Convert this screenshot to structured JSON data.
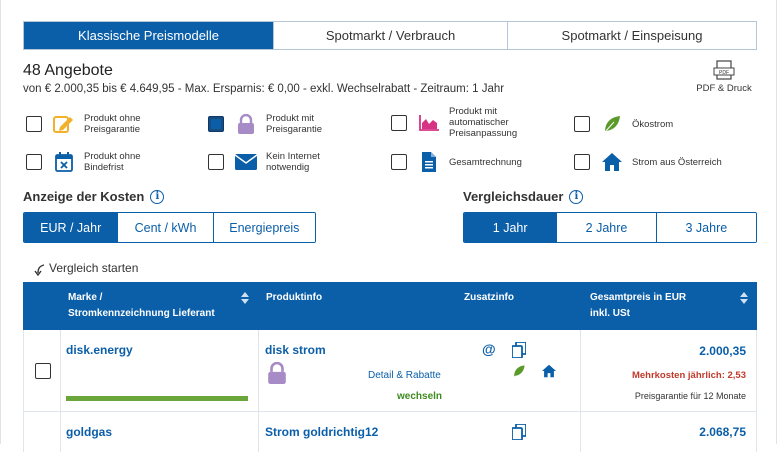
{
  "tabs": [
    "Klassische Preismodelle",
    "Spotmarkt / Verbrauch",
    "Spotmarkt / Einspeisung"
  ],
  "results": {
    "count": "48 Angebote",
    "summary": "von € 2.000,35 bis € 4.649,95 - Max. Ersparnis: € 0,00 - exkl. Wechselrabatt - Zeitraum: 1 Jahr"
  },
  "pdf": {
    "label": "PDF & Druck",
    "icon_text": "PDF"
  },
  "filters": [
    {
      "label": "Produkt ohne Preisgarantie",
      "icon": "edit-icon",
      "checked": false
    },
    {
      "label": "Produkt mit Preisgarantie",
      "icon": "lock-icon",
      "checked": true
    },
    {
      "label": "Produkt mit automatischer Preisanpassung",
      "icon": "area-chart-icon",
      "checked": false
    },
    {
      "label": "Ökostrom",
      "icon": "leaf-icon",
      "checked": false
    },
    {
      "label": "Produkt ohne Bindefrist",
      "icon": "calendar-x-icon",
      "checked": false
    },
    {
      "label": "Kein Internet notwendig",
      "icon": "envelope-icon",
      "checked": false
    },
    {
      "label": "Gesamtrechnung",
      "icon": "document-icon",
      "checked": false
    },
    {
      "label": "Strom aus Österreich",
      "icon": "house-icon",
      "checked": false
    }
  ],
  "cost_display": {
    "title": "Anzeige der Kosten",
    "options": [
      "EUR / Jahr",
      "Cent / kWh",
      "Energiepreis"
    ],
    "selected": "EUR / Jahr"
  },
  "comparison_period": {
    "title": "Vergleichsdauer",
    "options": [
      "1 Jahr",
      "2 Jahre",
      "3 Jahre"
    ],
    "selected": "1 Jahr"
  },
  "compare_label": "Vergleich starten",
  "table": {
    "headers": {
      "brand": [
        "Marke /",
        "Stromkennzeichnung Lieferant"
      ],
      "product": "Produktinfo",
      "extra": "Zusatzinfo",
      "price": [
        "Gesamtpreis in EUR",
        "inkl. USt"
      ]
    },
    "rows": [
      {
        "brand": "disk.energy",
        "product": "disk strom",
        "details_link": "Detail & Rabatte",
        "switch_label": "wechseln",
        "price": "2.000,35",
        "extra_cost": "Mehrkosten jährlich: 2,53",
        "guarantee": "Preisgarantie für 12 Monate",
        "icons": [
          "at-icon",
          "copy-icon",
          "leaf-icon",
          "house-icon"
        ]
      },
      {
        "brand": "goldgas",
        "product": "Strom goldrichtig12",
        "price": "2.068,75",
        "icons": [
          "copy-icon"
        ]
      }
    ]
  },
  "colors": {
    "primary": "#0b5ea8",
    "green": "#6aa63a",
    "red": "#c0392b",
    "gold": "#f2b12b",
    "purple": "#a78bc6",
    "pink": "#d63384"
  }
}
